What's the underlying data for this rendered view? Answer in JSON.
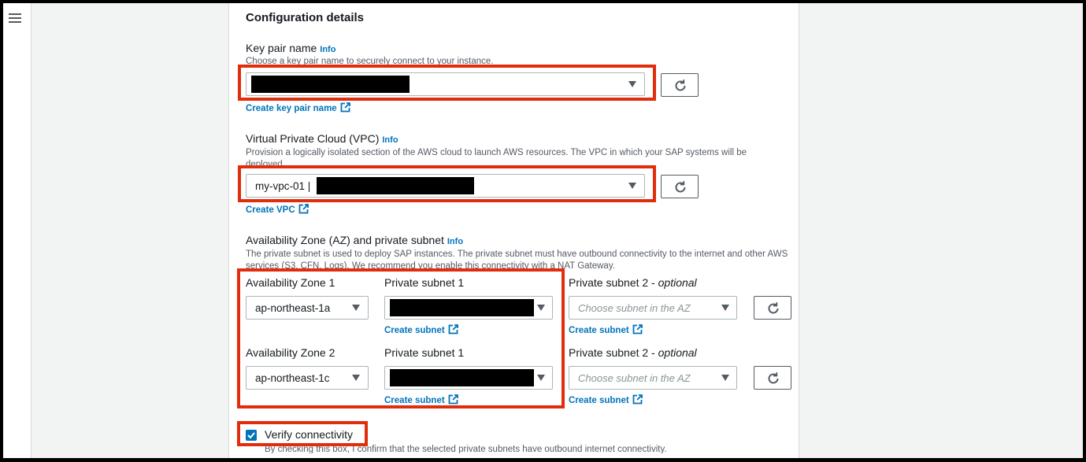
{
  "sidebar": {
    "menu_icon": "hamburger-menu-icon"
  },
  "section": {
    "title": "Configuration details"
  },
  "key_pair": {
    "label": "Key pair name",
    "info": "Info",
    "description": "Choose a key pair name to securely connect to your instance.",
    "value": "",
    "create_link": "Create key pair name"
  },
  "vpc": {
    "label": "Virtual Private Cloud (VPC)",
    "info": "Info",
    "description": "Provision a logically isolated section of the AWS cloud to launch AWS resources. The VPC in which your SAP systems will be deployed.",
    "value": "my-vpc-01 |",
    "create_link": "Create VPC"
  },
  "az": {
    "label": "Availability Zone (AZ) and private subnet",
    "info": "Info",
    "description": "The private subnet is used to deploy SAP instances. The private subnet must have outbound connectivity to the internet and other AWS services (S3, CFN, Logs). We recommend you enable this connectivity with a NAT Gateway.",
    "rows": [
      {
        "az_label": "Availability Zone 1",
        "az_value": "ap-northeast-1a",
        "subnet1_label": "Private subnet 1",
        "subnet1_link": "Create subnet",
        "subnet2_label": "Private subnet 2 - ",
        "subnet2_optional": "optional",
        "subnet2_placeholder": "Choose subnet in the AZ",
        "subnet2_link": "Create subnet"
      },
      {
        "az_label": "Availability Zone 2",
        "az_value": "ap-northeast-1c",
        "subnet1_label": "Private subnet 1",
        "subnet1_link": "Create subnet",
        "subnet2_label": "Private subnet 2 - ",
        "subnet2_optional": "optional",
        "subnet2_placeholder": "Choose subnet in the AZ",
        "subnet2_link": "Create subnet"
      }
    ]
  },
  "verify": {
    "label": "Verify connectivity",
    "checked": true,
    "description": "By checking this box, I confirm that the selected private subnets have outbound internet connectivity."
  },
  "colors": {
    "link": "#0073bb",
    "highlight": "#e22d0c",
    "checkbox": "#0073bb"
  },
  "icons": {
    "refresh": "refresh-icon",
    "external": "external-link-icon",
    "caret": "caret-down-icon",
    "check": "check-icon"
  }
}
